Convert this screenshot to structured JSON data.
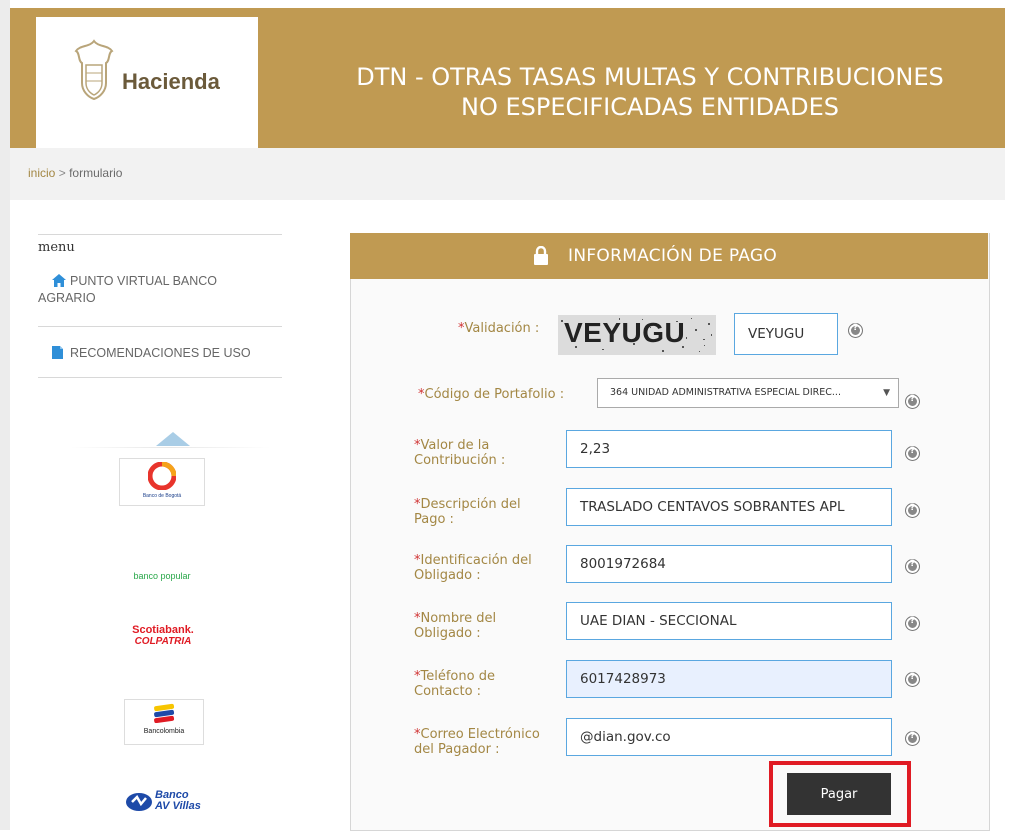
{
  "header": {
    "logo_text": "Hacienda",
    "title_line1": "DTN - OTRAS TASAS MULTAS Y CONTRIBUCIONES",
    "title_line2": "NO ESPECIFICADAS ENTIDADES"
  },
  "breadcrumb": {
    "home": "inicio",
    "separator": ">",
    "current": "formulario"
  },
  "menu": {
    "title": "menu",
    "items": [
      {
        "label_line1": "PUNTO VIRTUAL BANCO",
        "label_line2": "AGRARIO",
        "icon": "home-icon"
      },
      {
        "label_line1": "RECOMENDACIONES DE USO",
        "icon": "document-icon"
      }
    ]
  },
  "banks": [
    {
      "name": "Banco de Bogotá",
      "icon": "banco-bogota-logo"
    },
    {
      "name": "banco popular",
      "icon": "banco-popular-logo"
    },
    {
      "name_line1": "Scotiabank.",
      "name_line2": "COLPATRIA",
      "icon": "scotiabank-logo"
    },
    {
      "name": "Bancolombia",
      "icon": "bancolombia-logo"
    },
    {
      "name_line1": "Banco",
      "name_line2": "AV Villas",
      "icon": "av-villas-logo"
    }
  ],
  "form": {
    "heading": "INFORMACIÓN DE PAGO",
    "required_mark": "*",
    "validation": {
      "label": "Validación :",
      "captcha_text": "VEYUGU",
      "value": "VEYUGU"
    },
    "portfolio": {
      "label": "Código de Portafolio :",
      "selected": "364 UNIDAD ADMINISTRATIVA ESPECIAL DIREC...",
      "caret": "▼"
    },
    "contribution": {
      "label_line1": "Valor de la",
      "label_line2": "Contribución :",
      "value": "2,23"
    },
    "description": {
      "label_line1": "Descripción del",
      "label_line2": "Pago :",
      "value": "TRASLADO CENTAVOS SOBRANTES APL"
    },
    "identification": {
      "label_line1": "Identificación del",
      "label_line2": "Obligado :",
      "value": "8001972684"
    },
    "name": {
      "label_line1": "Nombre del",
      "label_line2": "Obligado :",
      "value": "UAE DIAN - SECCIONAL"
    },
    "phone": {
      "label_line1": "Teléfono de",
      "label_line2": "Contacto :",
      "value": "6017428973"
    },
    "email": {
      "label_line1": "Correo Electrónico",
      "label_line2": "del Pagador :",
      "value": "@dian.gov.co"
    },
    "submit": "Pagar"
  },
  "colors": {
    "brand_gold": "#c09a52",
    "label_gold": "#a38744",
    "input_border": "#5aa7e0",
    "highlight": "#e01b24",
    "button": "#333333"
  }
}
